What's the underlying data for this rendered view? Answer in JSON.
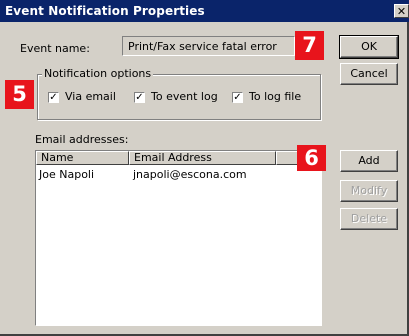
{
  "window": {
    "title": "Event Notification Properties",
    "close_glyph": "✕"
  },
  "event_name": {
    "label": "Event name:",
    "value": "Print/Fax service fatal error"
  },
  "buttons": {
    "ok": "OK",
    "cancel": "Cancel",
    "add": "Add",
    "modify": "Modify",
    "delete": "Delete"
  },
  "notification_options": {
    "legend": "Notification options",
    "options": [
      {
        "label": "Via email",
        "checked": true
      },
      {
        "label": "To event log",
        "checked": true
      },
      {
        "label": "To log file",
        "checked": true
      }
    ]
  },
  "email_addresses": {
    "label": "Email addresses:",
    "columns": [
      "Name",
      "Email Address"
    ],
    "rows": [
      {
        "name": "Joe Napoli",
        "email": "jnapoli@escona.com"
      }
    ]
  },
  "callouts": {
    "five": "5",
    "six": "6",
    "seven": "7"
  },
  "colors": {
    "titlebar": "#0a246a",
    "dialog_face": "#d4d0c8",
    "callout": "#e8141c"
  }
}
